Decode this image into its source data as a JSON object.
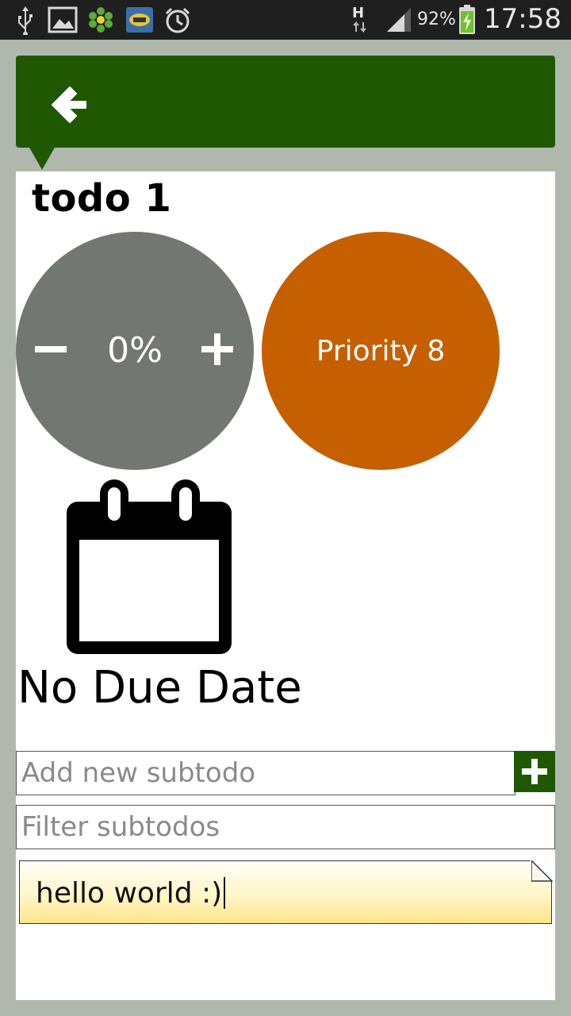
{
  "status_bar": {
    "battery": "92%",
    "time": "17:58",
    "network": "H",
    "icons": [
      "usb-icon",
      "gallery-icon",
      "icq-icon",
      "mail-app-icon",
      "alarm-icon",
      "signal-icon",
      "battery-charging-icon"
    ]
  },
  "header": {
    "back_icon": "back-arrow-icon",
    "color": "#1f5800"
  },
  "todo": {
    "title": "todo 1",
    "progress": {
      "value": "0%",
      "decrease_icon": "minus-icon",
      "increase_icon": "plus-icon",
      "color": "#727771"
    },
    "priority": {
      "label": "Priority 8",
      "color": "#c65f00"
    },
    "due_date": {
      "icon": "calendar-icon",
      "label": "No Due Date"
    }
  },
  "subtodos": {
    "add_placeholder": "Add new subtodo",
    "add_button_icon": "plus-icon",
    "filter_placeholder": "Filter subtodos",
    "note_text": "hello world :)"
  }
}
